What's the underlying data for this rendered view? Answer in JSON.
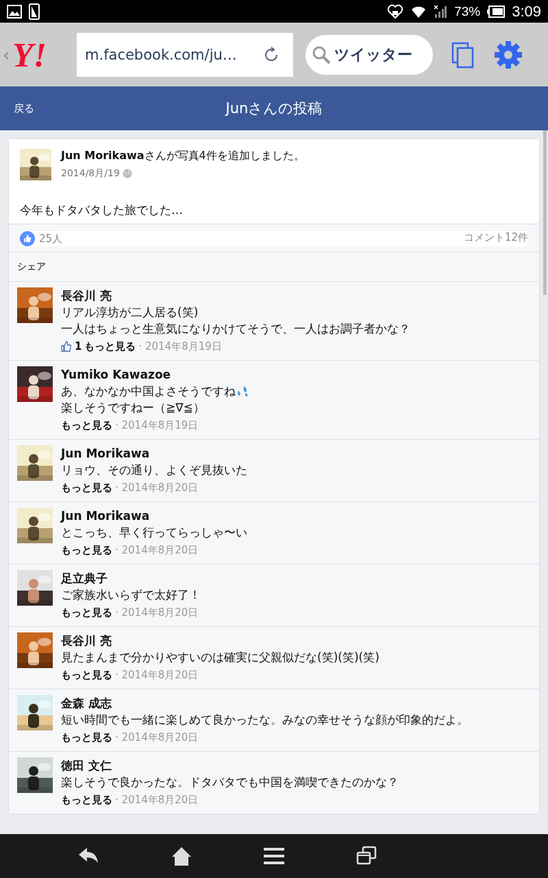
{
  "status_bar": {
    "battery": "73%",
    "time": "3:09"
  },
  "browser": {
    "back": "‹",
    "logo": "Y!",
    "url": "m.facebook.com/ju…",
    "search": "ツイッター"
  },
  "header": {
    "back": "戻る",
    "title": "Junさんの投稿"
  },
  "post": {
    "avatar": {
      "kind": "picture"
    },
    "author": "Jun Morikawa",
    "action": "さんが写真4件を追加しました。",
    "date": "2014/8月/19",
    "text": "今年もドタバタした旅でした…",
    "likes": "25人",
    "comments": "コメント12件",
    "share": "シェア"
  },
  "comments": [
    {
      "name": "長谷川 亮",
      "avatar": {
        "kind": "picture"
      },
      "lines": [
        "リアル淳坊が二人居る(笑)",
        "一人はちょっと生意気になりかけてそうで、一人はお調子者かな？"
      ],
      "like_count": "1",
      "more": "もっと見る",
      "date": "· 2014年8月19日"
    },
    {
      "name": "Yumiko Kawazoe",
      "avatar": {
        "kind": "picture"
      },
      "lines": [
        "あ、なかなか中国よさそうですね",
        "楽しそうですねー（≧∇≦）"
      ],
      "more": "もっと見る",
      "date": "· 2014年8月19日"
    },
    {
      "name": "Jun Morikawa",
      "avatar": {
        "kind": "picture"
      },
      "lines": [
        "リョウ、その通り、よくぞ見抜いた"
      ],
      "more": "もっと見る",
      "date": "· 2014年8月20日"
    },
    {
      "name": "Jun Morikawa",
      "avatar": {
        "kind": "picture"
      },
      "lines": [
        "とこっち、早く行ってらっしゃ〜い"
      ],
      "more": "もっと見る",
      "date": "· 2014年8月20日"
    },
    {
      "name": "足立典子",
      "avatar": {
        "kind": "picture"
      },
      "lines": [
        "ご家族水いらずで太好了！"
      ],
      "more": "もっと見る",
      "date": "· 2014年8月20日"
    },
    {
      "name": "長谷川 亮",
      "avatar": {
        "kind": "picture"
      },
      "lines": [
        "見たまんまで分かりやすいのは確実に父親似だな(笑)(笑)(笑)"
      ],
      "more": "もっと見る",
      "date": "· 2014年8月20日"
    },
    {
      "name": "金森 成志",
      "avatar": {
        "kind": "picture"
      },
      "lines": [
        "短い時間でも一緒に楽しめて良かったな。みなの幸せそうな顔が印象的だよ。"
      ],
      "more": "もっと見る",
      "date": "· 2014年8月20日"
    },
    {
      "name": "徳田 文仁",
      "avatar": {
        "kind": "picture"
      },
      "lines": [
        "楽しそうで良かったな。ドタバタでも中国を満喫できたのかな？"
      ],
      "more": "もっと見る",
      "date": "· 2014年8月20日"
    }
  ]
}
